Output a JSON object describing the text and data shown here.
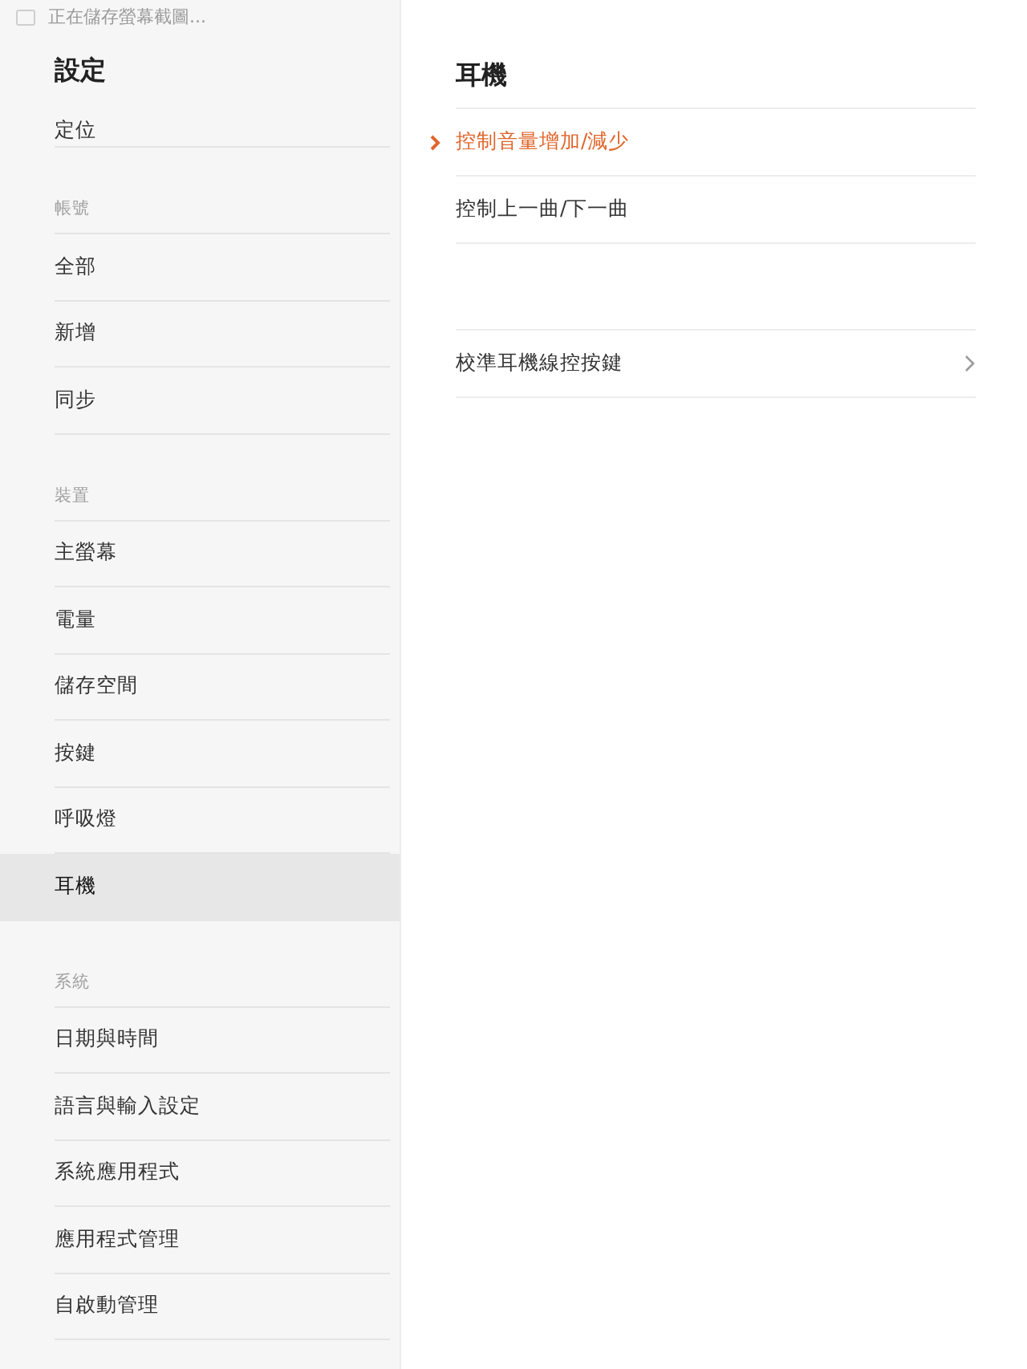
{
  "status_bar": {
    "text": "正在儲存螢幕截圖..."
  },
  "sidebar": {
    "title": "設定",
    "sections": [
      {
        "items": [
          {
            "label": "定位",
            "selected": false
          }
        ]
      },
      {
        "header": "帳號",
        "items": [
          {
            "label": "全部",
            "selected": false
          },
          {
            "label": "新增",
            "selected": false
          },
          {
            "label": "同步",
            "selected": false
          }
        ]
      },
      {
        "header": "裝置",
        "items": [
          {
            "label": "主螢幕",
            "selected": false
          },
          {
            "label": "電量",
            "selected": false
          },
          {
            "label": "儲存空間",
            "selected": false
          },
          {
            "label": "按鍵",
            "selected": false
          },
          {
            "label": "呼吸燈",
            "selected": false
          },
          {
            "label": "耳機",
            "selected": true
          }
        ]
      },
      {
        "header": "系統",
        "items": [
          {
            "label": "日期與時間",
            "selected": false
          },
          {
            "label": "語言與輸入設定",
            "selected": false
          },
          {
            "label": "系統應用程式",
            "selected": false
          },
          {
            "label": "應用程式管理",
            "selected": false
          },
          {
            "label": "自啟動管理",
            "selected": false
          }
        ]
      }
    ]
  },
  "detail": {
    "title": "耳機",
    "groups": [
      {
        "options": [
          {
            "label": "控制音量增加/減少",
            "kind": "choice",
            "selected": true
          },
          {
            "label": "控制上一曲/下一曲",
            "kind": "choice",
            "selected": false
          }
        ]
      },
      {
        "options": [
          {
            "label": "校準耳機線控按鍵",
            "kind": "link",
            "selected": false
          }
        ]
      }
    ]
  }
}
